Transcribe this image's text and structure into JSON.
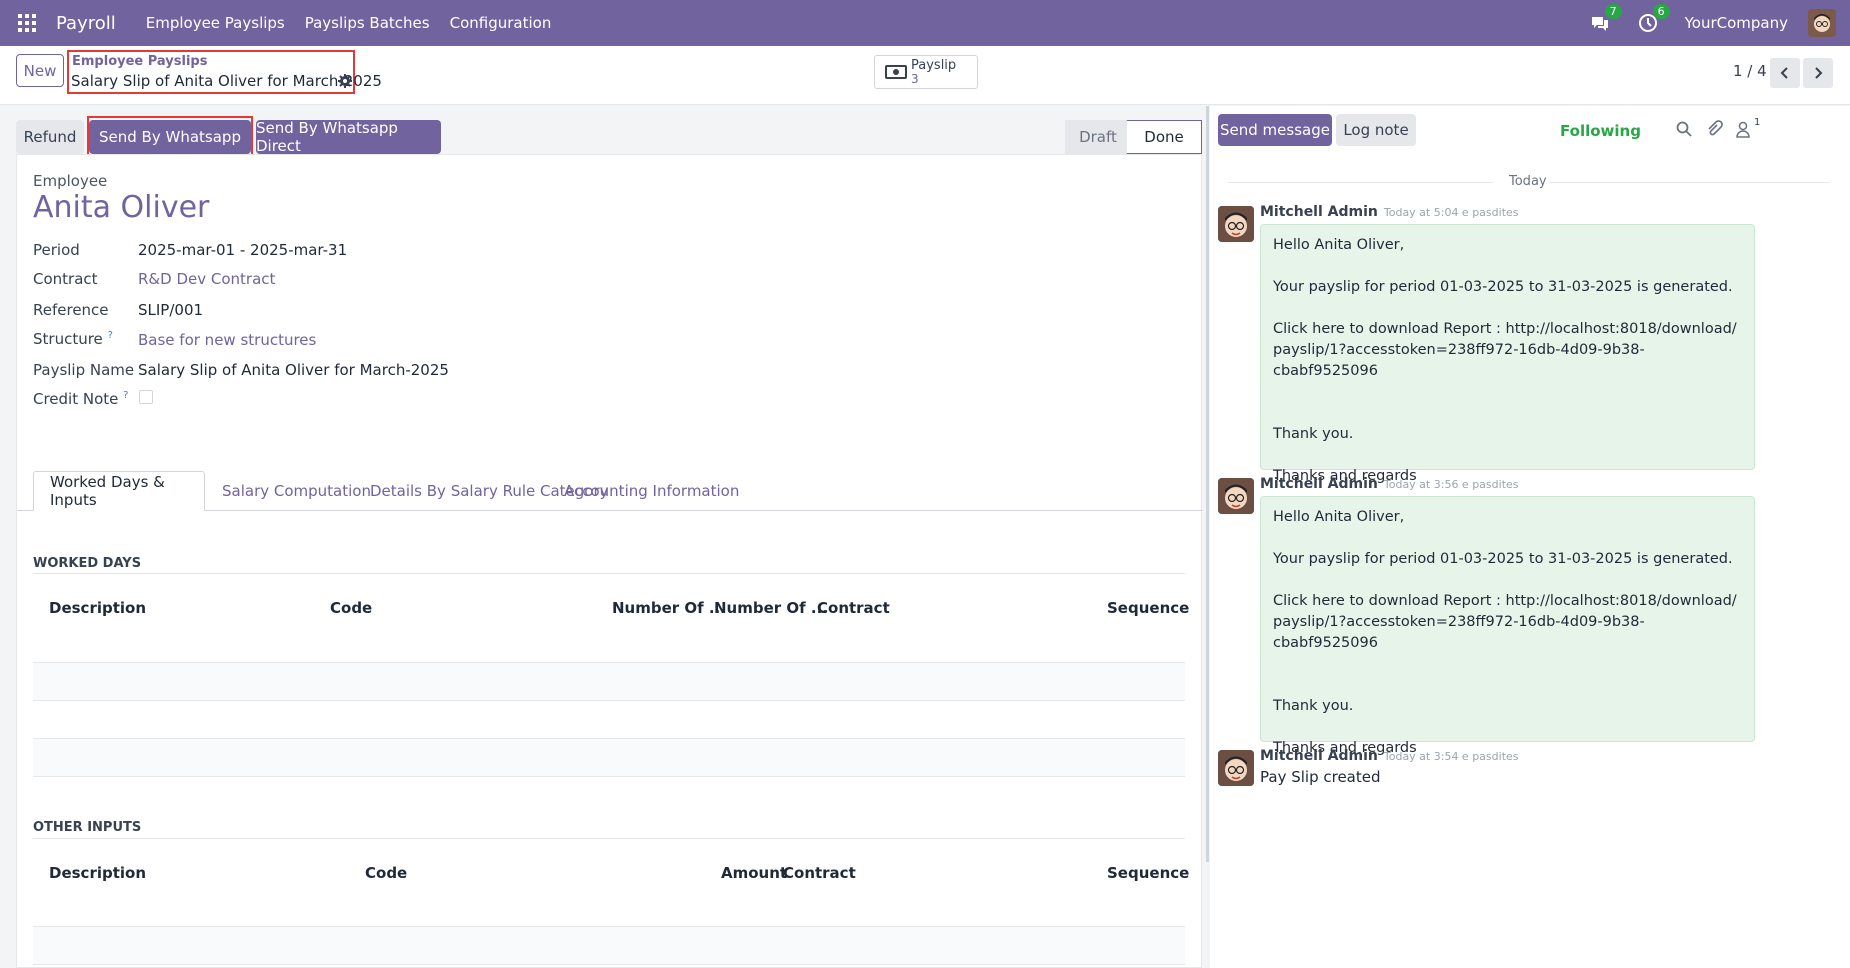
{
  "colors": {
    "brand": "#71639e",
    "highlight": "#e53935",
    "badge": "#28a745",
    "bubble": "#e6f4ea"
  },
  "topnav": {
    "app_name": "Payroll",
    "menus": [
      "Employee Payslips",
      "Payslips Batches",
      "Configuration"
    ],
    "chat_badge": "7",
    "activity_badge": "6",
    "company": "YourCompany"
  },
  "controlbar": {
    "new_label": "New",
    "breadcrumb_parent": "Employee Payslips",
    "breadcrumb_current": "Salary Slip of Anita Oliver for March-2025",
    "smart_button": {
      "label": "Payslip",
      "value": "3"
    },
    "pager": "1 / 4"
  },
  "statusbar": {
    "refund": "Refund",
    "send_whatsapp": "Send By Whatsapp",
    "send_whatsapp_direct": "Send By Whatsapp Direct",
    "stages": [
      "Draft",
      "Done"
    ],
    "active_stage": "Done"
  },
  "form": {
    "employee_label": "Employee",
    "employee_name": "Anita Oliver",
    "fields": {
      "period": {
        "label": "Period",
        "value": "2025-mar-01 - 2025-mar-31"
      },
      "contract": {
        "label": "Contract",
        "value": "R&D Dev Contract"
      },
      "reference": {
        "label": "Reference",
        "value": "SLIP/001"
      },
      "structure": {
        "label": "Structure",
        "value": "Base for new structures"
      },
      "payslip_name": {
        "label": "Payslip Name",
        "value": "Salary Slip of Anita Oliver for March-2025"
      },
      "credit_note": {
        "label": "Credit Note",
        "value": false
      }
    },
    "help_mark": "?",
    "tabs": [
      "Worked Days & Inputs",
      "Salary Computation",
      "Details By Salary Rule Category",
      "Accounting Information"
    ],
    "active_tab": "Worked Days & Inputs",
    "worked_days": {
      "title": "WORKED DAYS",
      "columns": [
        "Description",
        "Code",
        "Number Of ...",
        "Number Of ...",
        "Contract",
        "Sequence"
      ]
    },
    "other_inputs": {
      "title": "OTHER INPUTS",
      "columns": [
        "Description",
        "Code",
        "Amount",
        "Contract",
        "Sequence"
      ]
    }
  },
  "chatter": {
    "send_message": "Send message",
    "log_note": "Log note",
    "followers_count": "1",
    "following": "Following",
    "date_separator": "Today",
    "messages": [
      {
        "author": "Mitchell Admin",
        "time": "Today at 5:04 e pasdites",
        "lines": [
          "Hello Anita Oliver,",
          "",
          "Your payslip for period 01-03-2025 to 31-03-2025 is generated.",
          "",
          "Click here to download Report : http://localhost:8018/download/",
          "payslip/1?accesstoken=238ff972-16db-4d09-9b38-cbabf9525096",
          "",
          "",
          "Thank you.",
          "",
          "Thanks and regards"
        ]
      },
      {
        "author": "Mitchell Admin",
        "time": "Today at 3:56 e pasdites",
        "lines": [
          "Hello Anita Oliver,",
          "",
          "Your payslip for period 01-03-2025 to 31-03-2025 is generated.",
          "",
          "Click here to download Report : http://localhost:8018/download/",
          "payslip/1?accesstoken=238ff972-16db-4d09-9b38-cbabf9525096",
          "",
          "",
          "Thank you.",
          "",
          "Thanks and regards"
        ]
      },
      {
        "author": "Mitchell Admin",
        "time": "Today at 3:54 e pasdites",
        "text": "Pay Slip created"
      }
    ]
  }
}
